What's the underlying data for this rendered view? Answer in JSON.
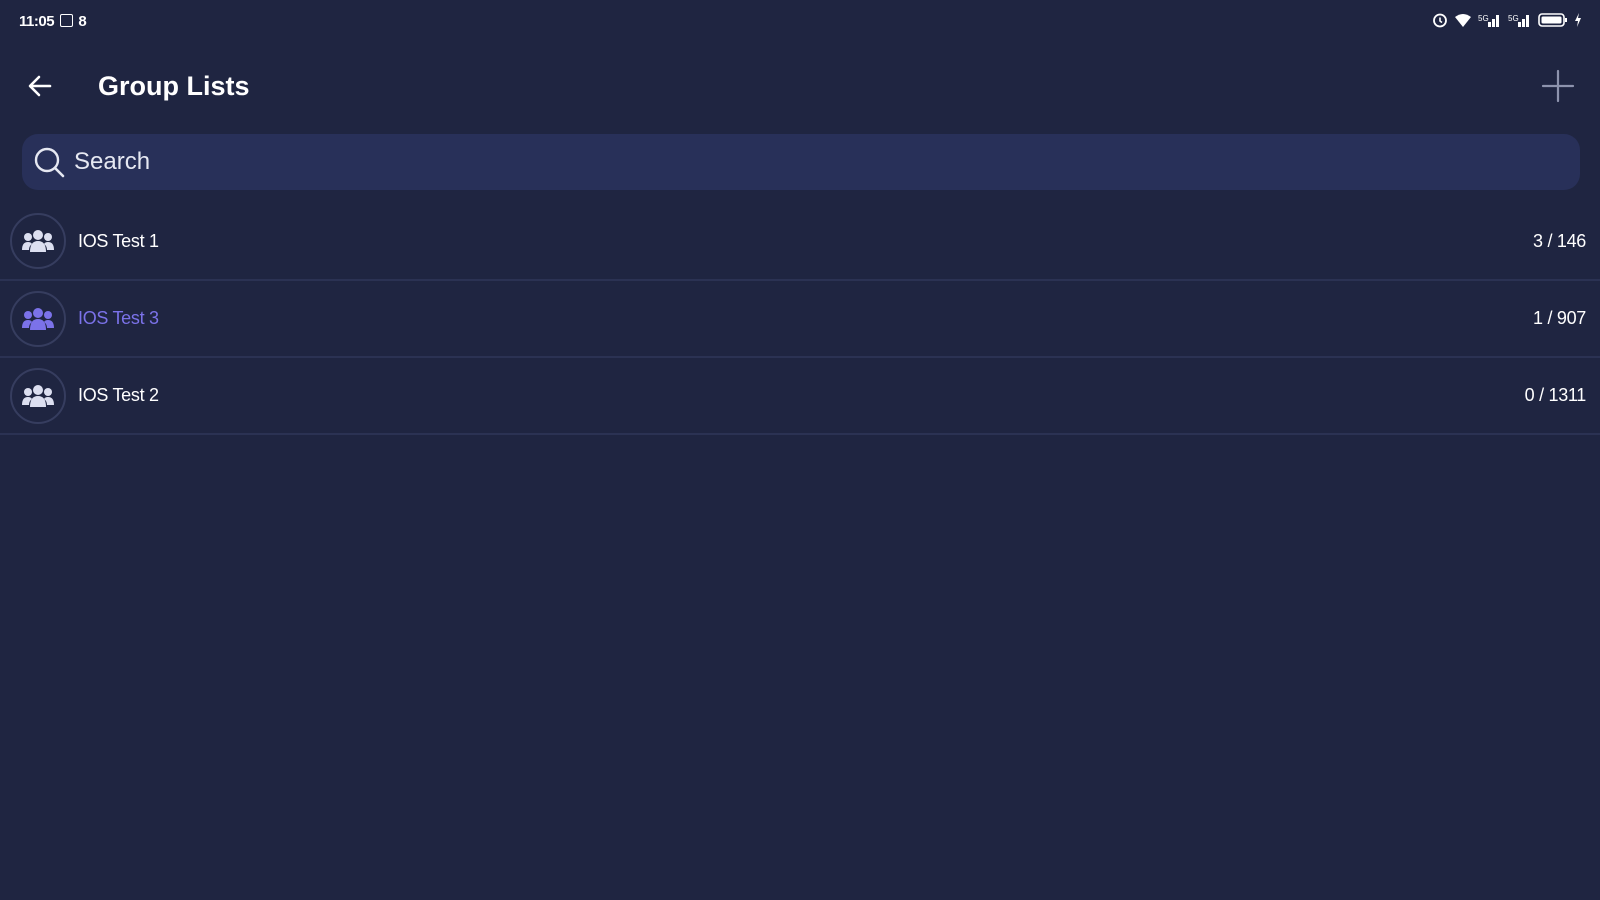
{
  "status_bar": {
    "time": "11:05",
    "extra": "8",
    "icons": [
      "alarm-icon",
      "wifi-icon",
      "signal-icon",
      "signal-icon",
      "battery-icon",
      "charging-icon"
    ]
  },
  "app_bar": {
    "title": "Group Lists",
    "back_icon": "arrow-left-icon",
    "add_icon": "plus-icon"
  },
  "search": {
    "placeholder": "Search",
    "value": ""
  },
  "groups": [
    {
      "name": "IOS Test 1",
      "count": "3 / 146",
      "highlighted": false
    },
    {
      "name": "IOS Test 3",
      "count": "1 / 907",
      "highlighted": true
    },
    {
      "name": "IOS Test 2",
      "count": "0 / 1311",
      "highlighted": false
    }
  ],
  "colors": {
    "background": "#1f2541",
    "search_background": "#283059",
    "divider": "#2b3253",
    "highlight": "#7b72e9",
    "text": "#ffffff"
  }
}
